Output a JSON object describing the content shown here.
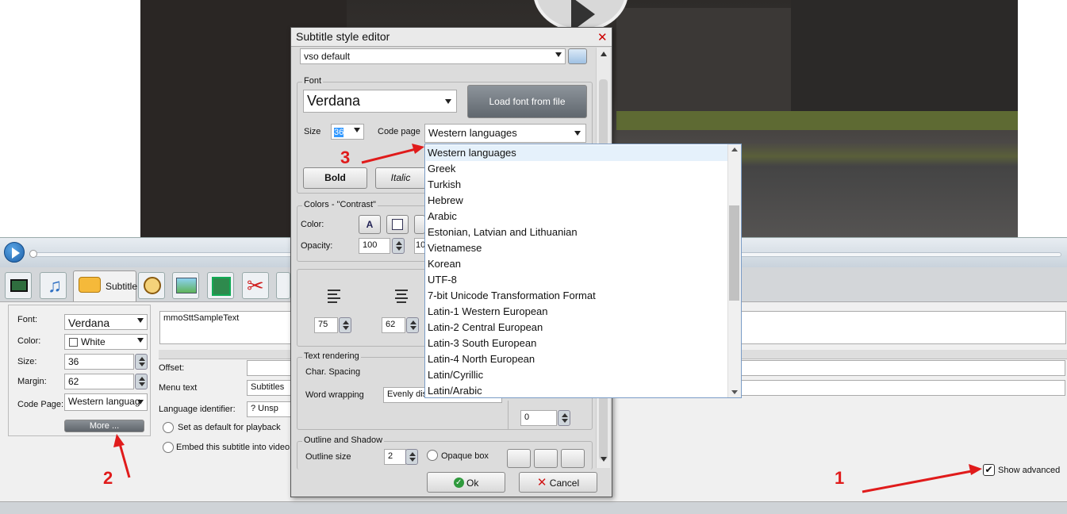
{
  "dialog": {
    "title": "Subtitle style editor",
    "preset": "vso default",
    "font_group": "Font",
    "font_name": "Verdana",
    "load_font_btn": "Load font from file",
    "size_label": "Size",
    "size_value": "36",
    "codepage_label": "Code page",
    "codepage_value": "Western languages",
    "bold_btn": "Bold",
    "italic_btn": "Italic",
    "colors_group": "Colors - \"Contrast\"",
    "color_label": "Color:",
    "opacity_label": "Opacity:",
    "opacity_value": "100",
    "opacity_value2": "10",
    "pos_value1": "75",
    "pos_value2": "62",
    "text_rendering_group": "Text rendering",
    "char_spacing_label": "Char. Spacing",
    "word_wrapping_label": "Word wrapping",
    "word_wrapping_value": "Evenly dist",
    "extra_value": "0",
    "outline_group": "Outline  and Shadow",
    "outline_size_label": "Outline size",
    "outline_size_value": "2",
    "opaque_box_label": "Opaque box",
    "ok_btn": "Ok",
    "cancel_btn": "Cancel"
  },
  "codepage_options": [
    "Western languages",
    "Greek",
    "Turkish",
    "Hebrew",
    "Arabic",
    "Estonian, Latvian and Lithuanian",
    "Vietnamese",
    "Korean",
    "UTF-8",
    "7-bit Unicode Transformation Format",
    "Latin-1 Western European",
    "Latin-2 Central European",
    "Latin-3 South European",
    "Latin-4 North European",
    "Latin/Cyrillic",
    "Latin/Arabic"
  ],
  "tabs": {
    "subtitle_label": "Subtitle"
  },
  "left_panel": {
    "font_label": "Font:",
    "font_value": "Verdana",
    "color_label": "Color:",
    "color_value": "White",
    "size_label": "Size:",
    "size_value": "36",
    "margin_label": "Margin:",
    "margin_value": "62",
    "codepage_label": "Code Page:",
    "codepage_value": "Western languag",
    "more_btn": "More ..."
  },
  "middle_panel": {
    "sample_text": "mmoSttSampleText",
    "offset_label": "Offset:",
    "menu_text_label": "Menu text",
    "menu_text_value": "Subtitles",
    "lang_label": "Language identifier:",
    "lang_value": "?  Unsp",
    "default_playback": "Set as default for playback",
    "embed": "Embed this subtitle into video"
  },
  "show_advanced": "Show advanced",
  "annotations": {
    "a1": "1",
    "a2": "2",
    "a3": "3"
  },
  "colors": {
    "annotation_red": "#e01b1b",
    "selection_blue": "#e5f1fb"
  }
}
